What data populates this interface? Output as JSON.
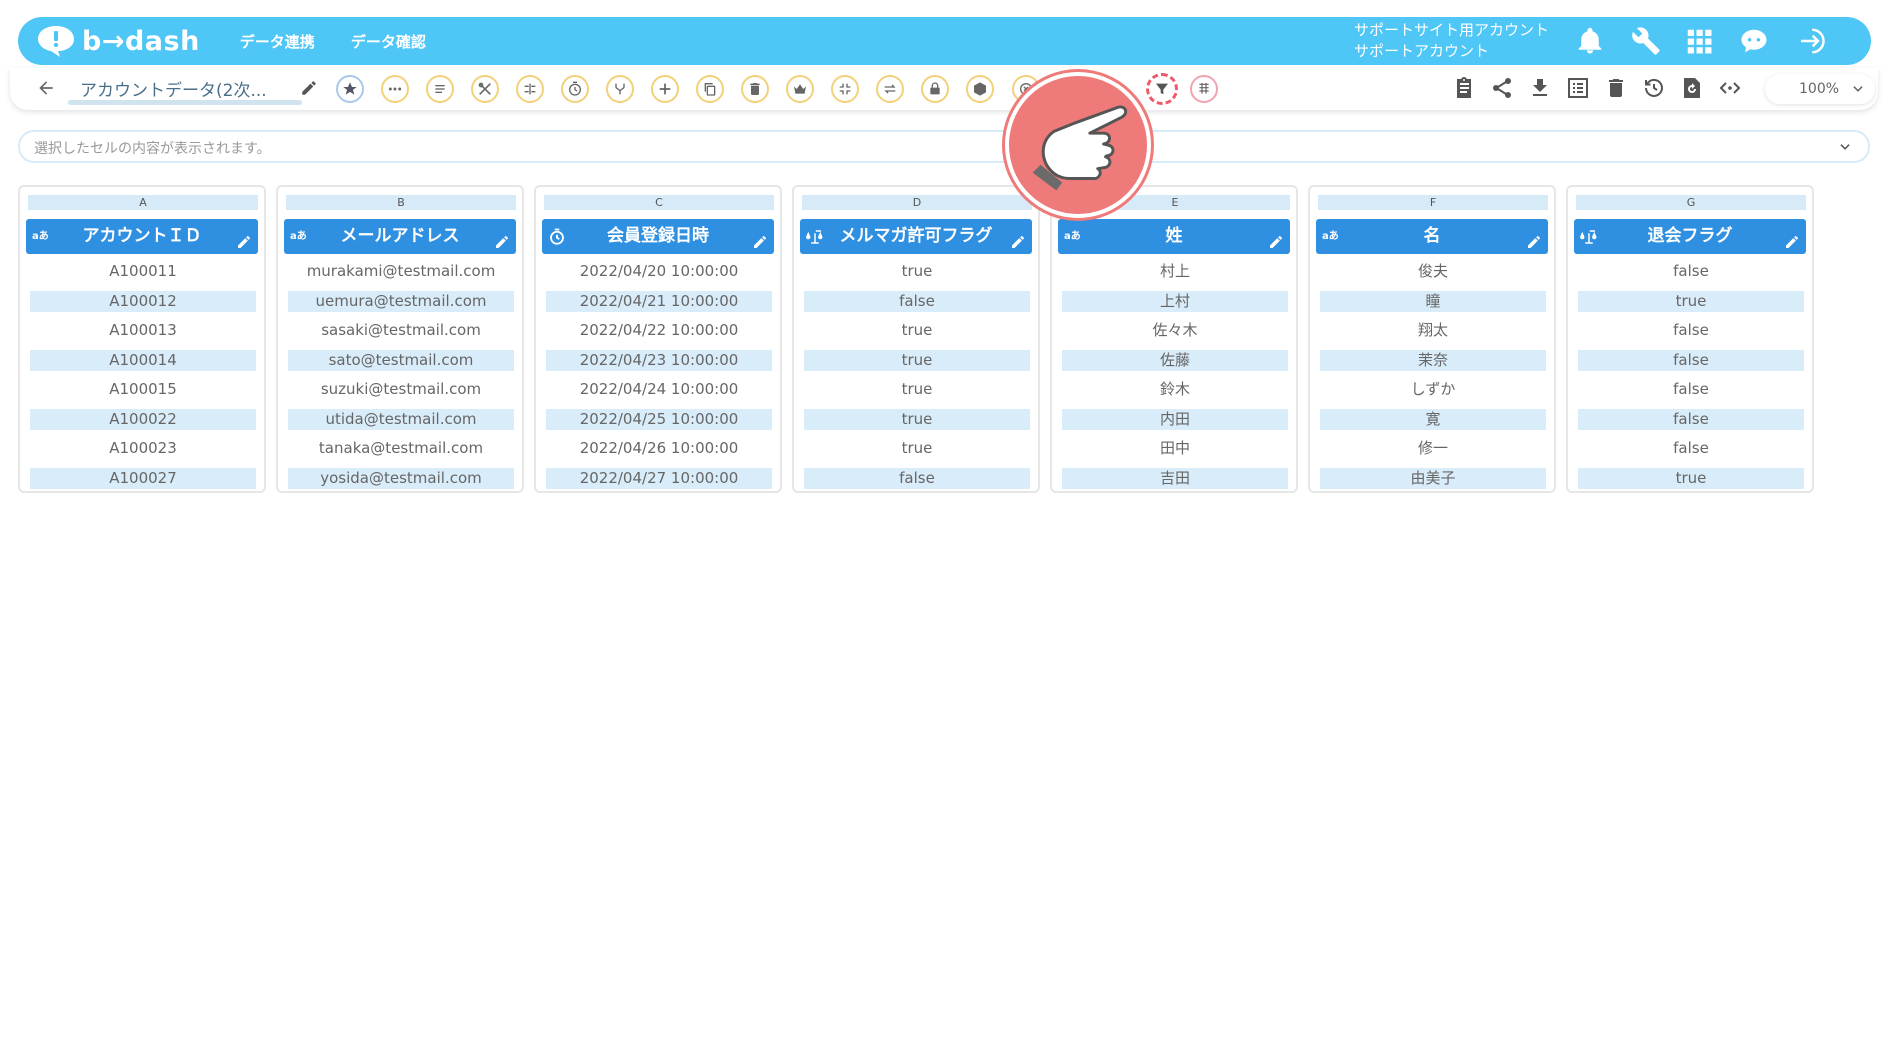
{
  "header": {
    "logo_text": "b→dash",
    "nav": [
      "データ連携",
      "データ確認"
    ],
    "account_line1": "サポートサイト用アカウント",
    "account_line2": "サポートアカウント"
  },
  "toolbar": {
    "flow_name": "アカウントデータ(2次...",
    "zoom": "100%"
  },
  "cell_preview": {
    "placeholder": "選択したセルの内容が表示されます。"
  },
  "columns": [
    {
      "letter": "A",
      "header": "アカウントＩＤ",
      "type_icon": "text-type-icon",
      "cells": [
        "A100011",
        "A100012",
        "A100013",
        "A100014",
        "A100015",
        "A100022",
        "A100023",
        "A100027"
      ]
    },
    {
      "letter": "B",
      "header": "メールアドレス",
      "type_icon": "text-type-icon",
      "cells": [
        "murakami@testmail.com",
        "uemura@testmail.com",
        "sasaki@testmail.com",
        "sato@testmail.com",
        "suzuki@testmail.com",
        "utida@testmail.com",
        "tanaka@testmail.com",
        "yosida@testmail.com"
      ]
    },
    {
      "letter": "C",
      "header": "会員登録日時",
      "type_icon": "datetime-type-icon",
      "cells": [
        "2022/04/20 10:00:00",
        "2022/04/21 10:00:00",
        "2022/04/22 10:00:00",
        "2022/04/23 10:00:00",
        "2022/04/24 10:00:00",
        "2022/04/25 10:00:00",
        "2022/04/26 10:00:00",
        "2022/04/27 10:00:00"
      ]
    },
    {
      "letter": "D",
      "header": "メルマガ許可フラグ",
      "type_icon": "boolean-type-icon",
      "cells": [
        "true",
        "false",
        "true",
        "true",
        "true",
        "true",
        "true",
        "false"
      ]
    },
    {
      "letter": "E",
      "header": "姓",
      "type_icon": "text-type-icon",
      "cells": [
        "村上",
        "上村",
        "佐々木",
        "佐藤",
        "鈴木",
        "内田",
        "田中",
        "吉田"
      ]
    },
    {
      "letter": "F",
      "header": "名",
      "type_icon": "text-type-icon",
      "cells": [
        "俊夫",
        "瞳",
        "翔太",
        "茉奈",
        "しずか",
        "寛",
        "修一",
        "由美子"
      ]
    },
    {
      "letter": "G",
      "header": "退会フラグ",
      "type_icon": "boolean-type-icon",
      "cells": [
        "false",
        "true",
        "false",
        "false",
        "false",
        "false",
        "false",
        "true"
      ]
    }
  ],
  "type_icon_text": "aあ",
  "colors": {
    "header_bg": "#4ec6f6",
    "column_header_bg": "#2f8fe1",
    "alt_row_bg": "#d9ecf9",
    "active_tool_border": "#ef5a6a",
    "pointer_circle": "#ef7a7a"
  }
}
